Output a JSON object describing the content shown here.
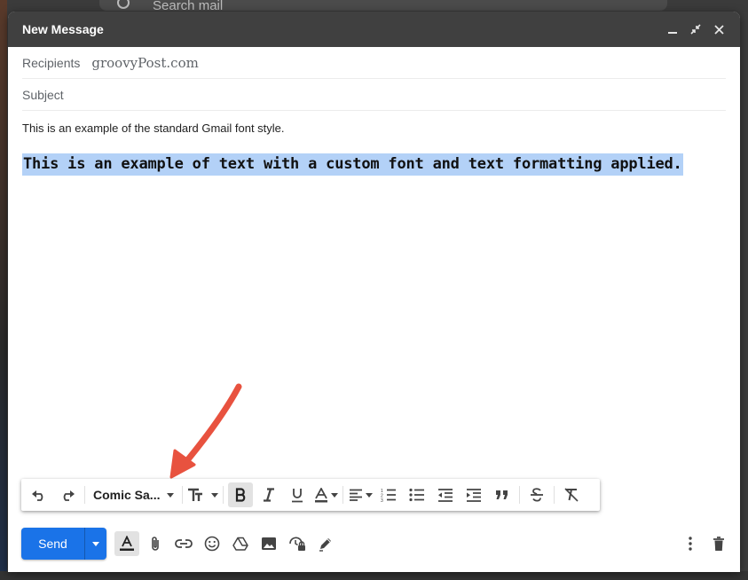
{
  "background": {
    "search_placeholder": "Search mail"
  },
  "compose": {
    "title": "New Message",
    "recipients_label": "Recipients",
    "recipients_value": "groovyPost.com",
    "subject_label": "Subject",
    "body_line1": "This is an example of the standard Gmail font style.",
    "body_line2": "This is an example of text with a custom font and text formatting applied."
  },
  "toolbar": {
    "font_name": "Comic Sa..."
  },
  "actions": {
    "send_label": "Send"
  },
  "colors": {
    "titlebar": "#404040",
    "send": "#1a73e8",
    "highlight": "#b3d1f7",
    "arrow": "#e8523f"
  },
  "icons": [
    "minimize-icon",
    "pop-out-icon",
    "close-icon",
    "undo-icon",
    "redo-icon",
    "text-size-icon",
    "bold-icon",
    "italic-icon",
    "underline-icon",
    "text-color-icon",
    "align-icon",
    "numbered-list-icon",
    "bulleted-list-icon",
    "indent-less-icon",
    "indent-more-icon",
    "quote-icon",
    "strikethrough-icon",
    "remove-formatting-icon",
    "formatting-options-icon",
    "attach-icon",
    "link-icon",
    "emoji-icon",
    "drive-icon",
    "photo-icon",
    "confidential-icon",
    "signature-icon",
    "more-options-icon",
    "trash-icon"
  ]
}
